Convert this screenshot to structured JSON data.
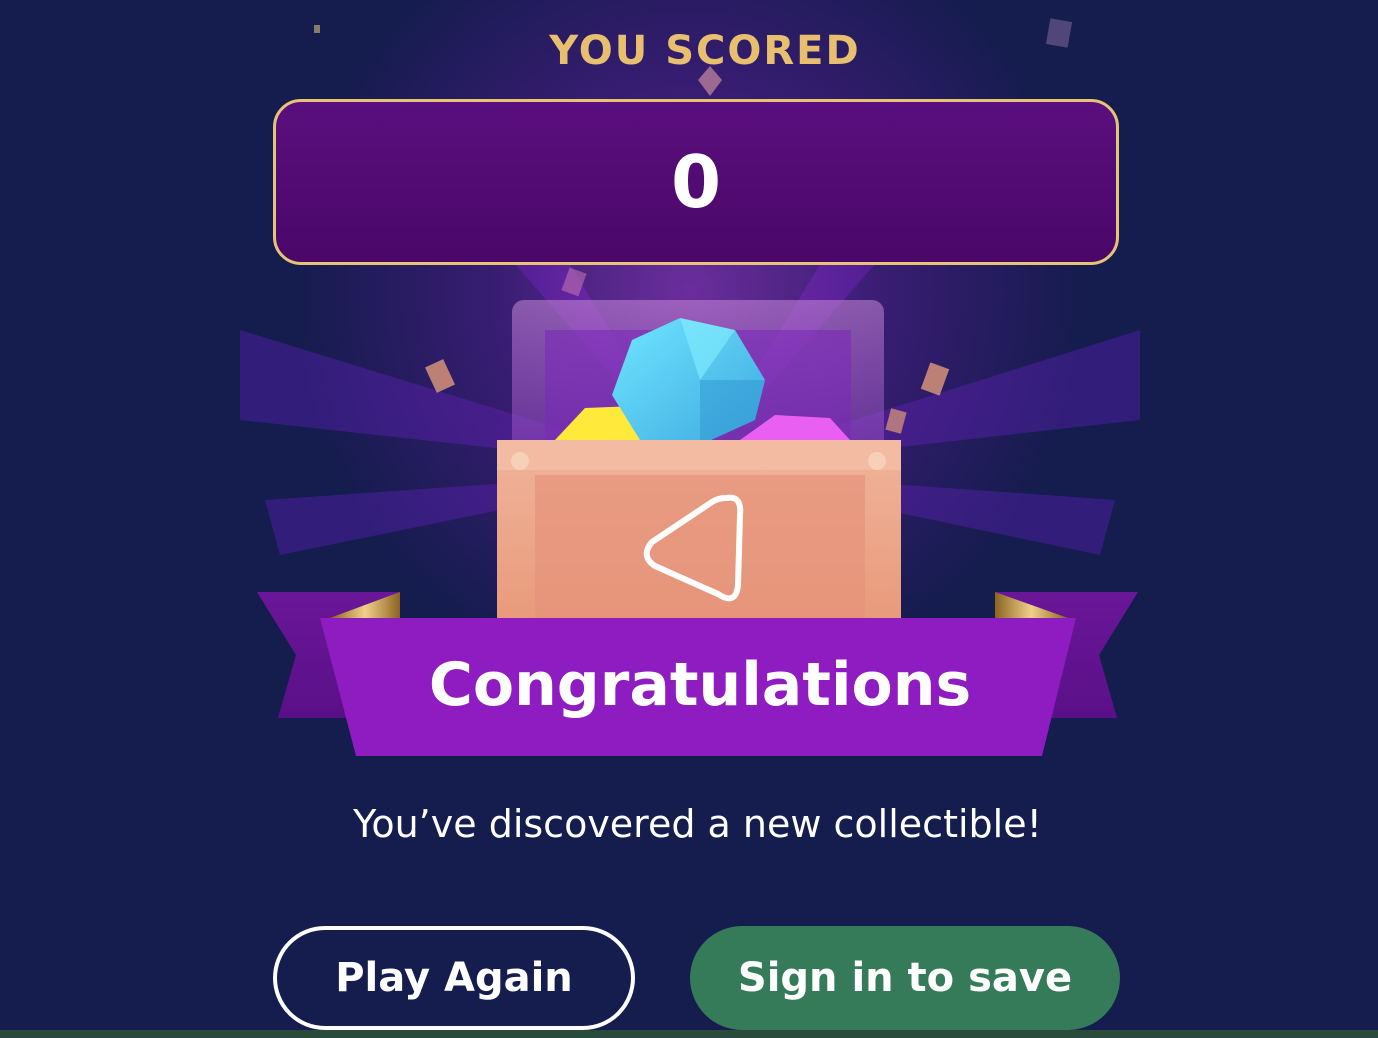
{
  "header": {
    "label": "YOU SCORED"
  },
  "score": {
    "value": "0"
  },
  "banner": {
    "title": "Congratulations"
  },
  "message": {
    "text": "You’ve discovered a new collectible!"
  },
  "buttons": {
    "play_again": "Play Again",
    "sign_in": "Sign in to save"
  },
  "colors": {
    "background": "#151c4e",
    "gold": "#e8bf6e",
    "score_box": "#4a0768",
    "ribbon": "#8e1cc0",
    "sign_in_button": "#357b59"
  },
  "icons": {
    "collectible": "treasure-chest-icon",
    "chest_emblem": "triangle-icon"
  }
}
